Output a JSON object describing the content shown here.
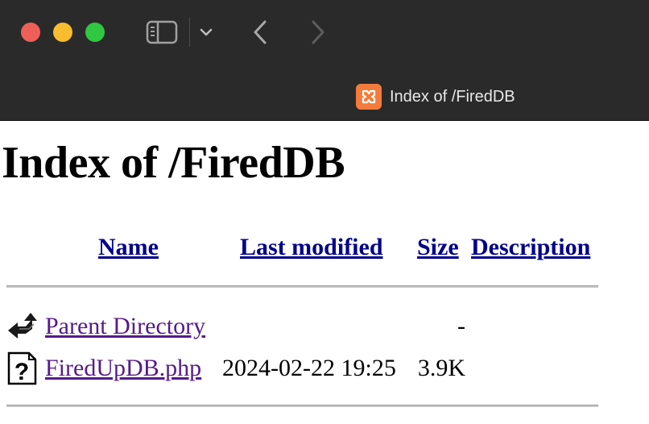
{
  "browser": {
    "tab_title": "Index of /FiredDB"
  },
  "page": {
    "heading": "Index of /FiredDB",
    "columns": {
      "name": "Name",
      "last_modified": "Last modified",
      "size": "Size",
      "description": "Description"
    },
    "rows": [
      {
        "name": "Parent Directory",
        "last_modified": "",
        "size": "-",
        "description": "",
        "icon": "back-arrow-icon"
      },
      {
        "name": "FiredUpDB.php",
        "last_modified": "2024-02-22 19:25",
        "size": "3.9K",
        "description": "",
        "icon": "unknown-file-icon"
      }
    ]
  },
  "colors": {
    "chrome_bg": "#2a2a2a",
    "link_visited": "#551a8b",
    "favicon": "#f37b3b"
  }
}
